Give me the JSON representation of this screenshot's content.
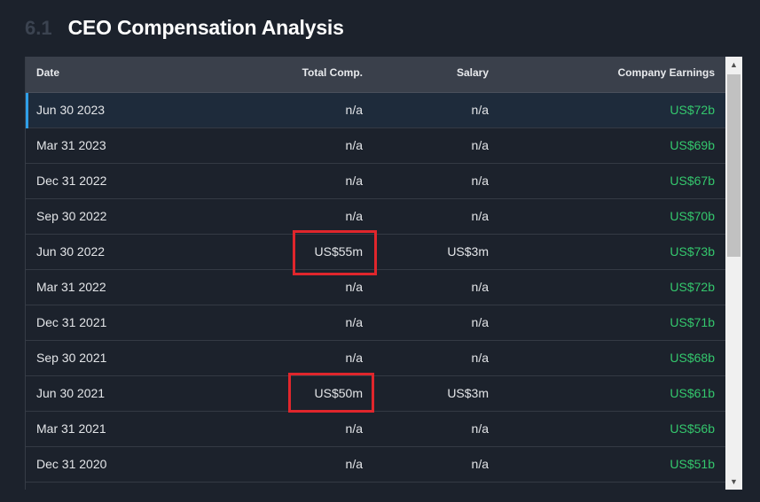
{
  "section": {
    "number": "6.1",
    "title": "CEO Compensation Analysis"
  },
  "table": {
    "headers": {
      "date": "Date",
      "total": "Total Comp.",
      "salary": "Salary",
      "earnings": "Company Earnings"
    },
    "rows": [
      {
        "date": "Jun 30 2023",
        "total": "n/a",
        "salary": "n/a",
        "earnings": "US$72b"
      },
      {
        "date": "Mar 31 2023",
        "total": "n/a",
        "salary": "n/a",
        "earnings": "US$69b"
      },
      {
        "date": "Dec 31 2022",
        "total": "n/a",
        "salary": "n/a",
        "earnings": "US$67b"
      },
      {
        "date": "Sep 30 2022",
        "total": "n/a",
        "salary": "n/a",
        "earnings": "US$70b"
      },
      {
        "date": "Jun 30 2022",
        "total": "US$55m",
        "salary": "US$3m",
        "earnings": "US$73b"
      },
      {
        "date": "Mar 31 2022",
        "total": "n/a",
        "salary": "n/a",
        "earnings": "US$72b"
      },
      {
        "date": "Dec 31 2021",
        "total": "n/a",
        "salary": "n/a",
        "earnings": "US$71b"
      },
      {
        "date": "Sep 30 2021",
        "total": "n/a",
        "salary": "n/a",
        "earnings": "US$68b"
      },
      {
        "date": "Jun 30 2021",
        "total": "US$50m",
        "salary": "US$3m",
        "earnings": "US$61b"
      },
      {
        "date": "Mar 31 2021",
        "total": "n/a",
        "salary": "n/a",
        "earnings": "US$56b"
      },
      {
        "date": "Dec 31 2020",
        "total": "n/a",
        "salary": "n/a",
        "earnings": "US$51b"
      },
      {
        "date": "",
        "total": "",
        "salary": "",
        "earnings": ""
      }
    ]
  },
  "colors": {
    "accent": "#2f9fe8",
    "earnings": "#34c76d",
    "highlight": "#e0262c",
    "background": "#1c222c"
  },
  "icons": {
    "scroll_up": "triangle-up",
    "scroll_down": "triangle-down"
  }
}
